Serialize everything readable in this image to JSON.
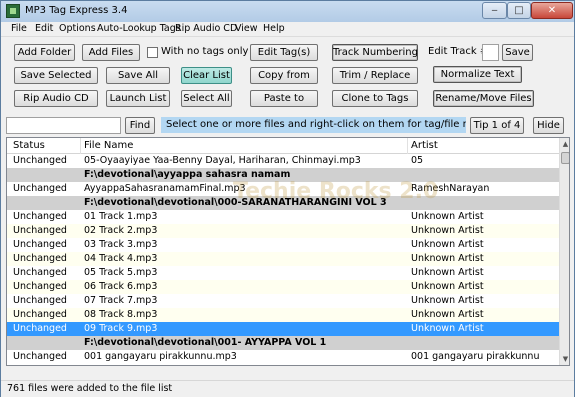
{
  "window": {
    "title": "MP3 Tag Express 3.4",
    "minimize": "‒",
    "maximize": "□",
    "close": "✕"
  },
  "menu": [
    "File",
    "Edit",
    "Options",
    "Auto-Lookup Tags",
    "Rip Audio CD",
    "View",
    "Help"
  ],
  "toolbar": {
    "add_folder": "Add Folder",
    "add_files": "Add Files",
    "with_no_tags_only": "With no tags only",
    "save_selected": "Save Selected",
    "save_all": "Save All",
    "clear_list": "Clear List",
    "rip_audio_cd": "Rip Audio CD",
    "launch_list": "Launch List",
    "select_all": "Select All",
    "edit_tags": "Edit Tag(s)",
    "track_numbering": "Track Numbering",
    "edit_track_label": "Edit Track #",
    "edit_track_value": "",
    "save": "Save",
    "copy_from": "Copy from",
    "trim_replace": "Trim / Replace",
    "normalize_text": "Normalize Text",
    "paste_to": "Paste to",
    "clone_to_tags": "Clone to Tags",
    "rename_move_files": "Rename/Move Files"
  },
  "search": {
    "value": "",
    "find": "Find",
    "tip": "Select one or more files and right-click on them for tag/file man",
    "tip_counter": "Tip 1 of 4",
    "hide": "Hide"
  },
  "table": {
    "headers": {
      "status": "Status",
      "file": "File Name",
      "artist": "Artist"
    },
    "rows": [
      {
        "type": "file",
        "status": "Unchanged",
        "file": "05-Oyaayiyae Yaa-Benny Dayal, Hariharan, Chinmayi.mp3",
        "artist": "05"
      },
      {
        "type": "folder",
        "path": "F:\\devotional\\ayyappa sahasra namam"
      },
      {
        "type": "file",
        "status": "Unchanged",
        "file": "AyyappaSahasranamamFinal.mp3",
        "artist": "RameshNarayan"
      },
      {
        "type": "folder",
        "path": "F:\\devotional\\devotional\\000-SARANATHARANGINI VOL 3"
      },
      {
        "type": "file",
        "status": "Unchanged",
        "file": "01 Track 1.mp3",
        "artist": "Unknown Artist"
      },
      {
        "type": "file",
        "status": "Unchanged",
        "file": "02 Track 2.mp3",
        "artist": "Unknown Artist"
      },
      {
        "type": "file",
        "status": "Unchanged",
        "file": "03 Track 3.mp3",
        "artist": "Unknown Artist"
      },
      {
        "type": "file",
        "status": "Unchanged",
        "file": "04 Track 4.mp3",
        "artist": "Unknown Artist"
      },
      {
        "type": "file",
        "status": "Unchanged",
        "file": "05 Track 5.mp3",
        "artist": "Unknown Artist"
      },
      {
        "type": "file",
        "status": "Unchanged",
        "file": "06 Track 6.mp3",
        "artist": "Unknown Artist"
      },
      {
        "type": "file",
        "status": "Unchanged",
        "file": "07 Track 7.mp3",
        "artist": "Unknown Artist"
      },
      {
        "type": "file",
        "status": "Unchanged",
        "file": "08 Track 8.mp3",
        "artist": "Unknown Artist"
      },
      {
        "type": "file",
        "status": "Unchanged",
        "file": "09 Track 9.mp3",
        "artist": "Unknown Artist",
        "selected": true
      },
      {
        "type": "folder",
        "path": "F:\\devotional\\devotional\\001- AYYAPPA VOL 1"
      },
      {
        "type": "file",
        "status": "Unchanged",
        "file": "001 gangayaru pirakkunnu.mp3",
        "artist": "001 gangayaru pirakkunnu"
      }
    ]
  },
  "watermark": "Techie Rocks 2.0",
  "statusbar": {
    "text": "761 files were added to the file list"
  }
}
